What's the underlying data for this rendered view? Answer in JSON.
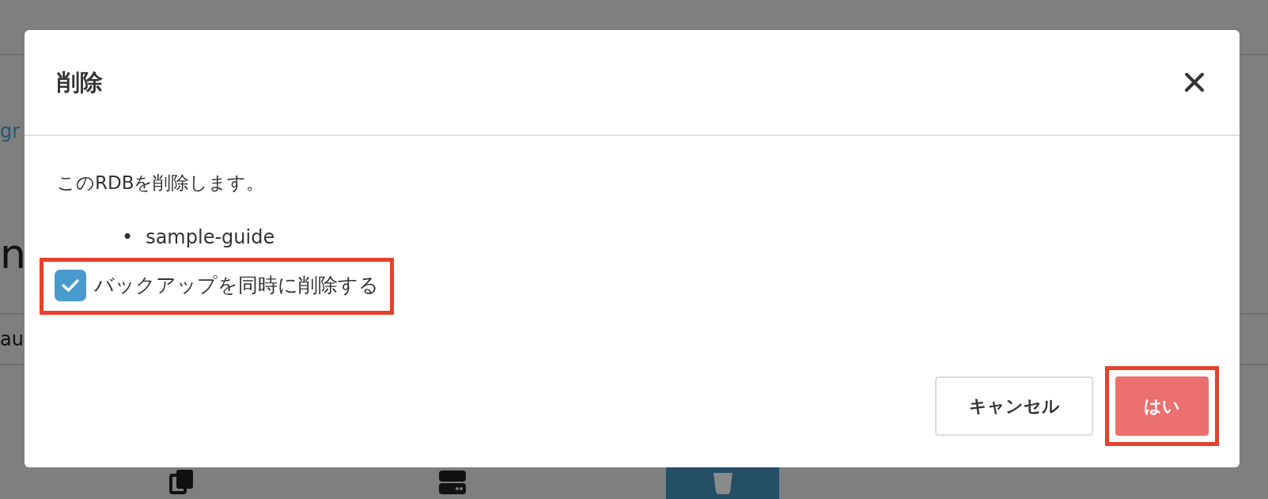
{
  "background": {
    "link_text": "gr",
    "heading_text": "n",
    "row_text": "au",
    "toolbar": [
      {
        "kind": "copy",
        "selected": false
      },
      {
        "kind": "server",
        "selected": false
      },
      {
        "kind": "trash",
        "selected": true
      }
    ]
  },
  "dialog": {
    "title": "削除",
    "message": "このRDBを削除します。",
    "items": [
      {
        "marker": "•",
        "text": "sample-guide"
      }
    ],
    "checkbox": {
      "label": "バックアップを同時に削除する",
      "checked": true,
      "highlighted": true
    },
    "buttons": [
      {
        "label": "キャンセル",
        "kind": "secondary",
        "highlighted": false
      },
      {
        "label": "はい",
        "kind": "danger",
        "highlighted": true
      }
    ]
  }
}
